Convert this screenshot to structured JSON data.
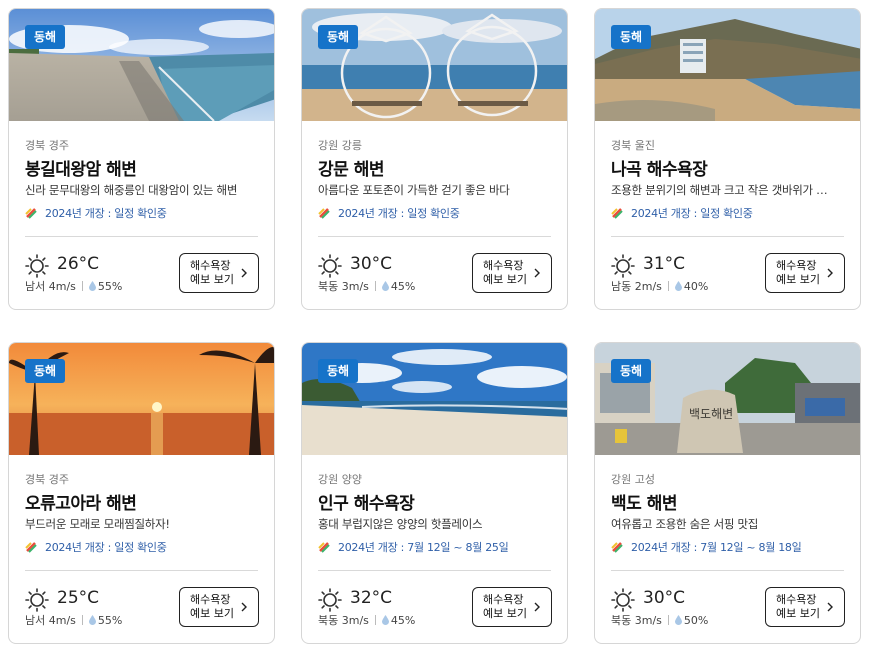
{
  "cards": [
    {
      "badge": "동해",
      "region": "경북 경주",
      "name": "봉길대왕암 해변",
      "desc": "신라 문무대왕의 해중릉인 대왕암이 있는 해변",
      "opening": "2024년 개장 : 일정 확인중",
      "temp": "26°C",
      "wind": "남서 4m/s",
      "humidity": "55%",
      "button_line1": "해수욕장",
      "button_line2": "예보 보기"
    },
    {
      "badge": "동해",
      "region": "강원 강릉",
      "name": "강문 해변",
      "desc": "아름다운 포토존이 가득한 걷기 좋은 바다",
      "opening": "2024년 개장 : 일정 확인중",
      "temp": "30°C",
      "wind": "북동 3m/s",
      "humidity": "45%",
      "button_line1": "해수욕장",
      "button_line2": "예보 보기"
    },
    {
      "badge": "동해",
      "region": "경북 울진",
      "name": "나곡 해수욕장",
      "desc": "조용한 분위기의 해변과 크고 작은 갯바위가 …",
      "opening": "2024년 개장 : 일정 확인중",
      "temp": "31°C",
      "wind": "남동 2m/s",
      "humidity": "40%",
      "button_line1": "해수욕장",
      "button_line2": "예보 보기"
    },
    {
      "badge": "동해",
      "region": "경북 경주",
      "name": "오류고아라 해변",
      "desc": "부드러운 모래로 모래찜질하자!",
      "opening": "2024년 개장 : 일정 확인중",
      "temp": "25°C",
      "wind": "남서 4m/s",
      "humidity": "55%",
      "button_line1": "해수욕장",
      "button_line2": "예보 보기"
    },
    {
      "badge": "동해",
      "region": "강원 양양",
      "name": "인구 해수욕장",
      "desc": "홍대 부럽지않은 양양의 핫플레이스",
      "opening": "2024년 개장 : 7월 12일 ~ 8월 25일",
      "temp": "32°C",
      "wind": "북동 3m/s",
      "humidity": "45%",
      "button_line1": "해수욕장",
      "button_line2": "예보 보기"
    },
    {
      "badge": "동해",
      "region": "강원 고성",
      "name": "백도 해변",
      "desc": "여유롭고 조용한 숨은 서핑 맛집",
      "opening": "2024년 개장 : 7월 12일 ~ 8월 18일",
      "temp": "30°C",
      "wind": "북동 3m/s",
      "humidity": "50%",
      "button_line1": "해수욕장",
      "button_line2": "예보 보기",
      "photo_text": "백도해변"
    }
  ],
  "colors": {
    "badge": "#1673c9",
    "opening_text": "#2f5fa8",
    "divider": "#d9d9d9"
  },
  "icons": {
    "weather": "sun-icon",
    "humidity": "water-drop-icon",
    "schedule": "calendar-icon",
    "button": "chevron-right-icon"
  }
}
